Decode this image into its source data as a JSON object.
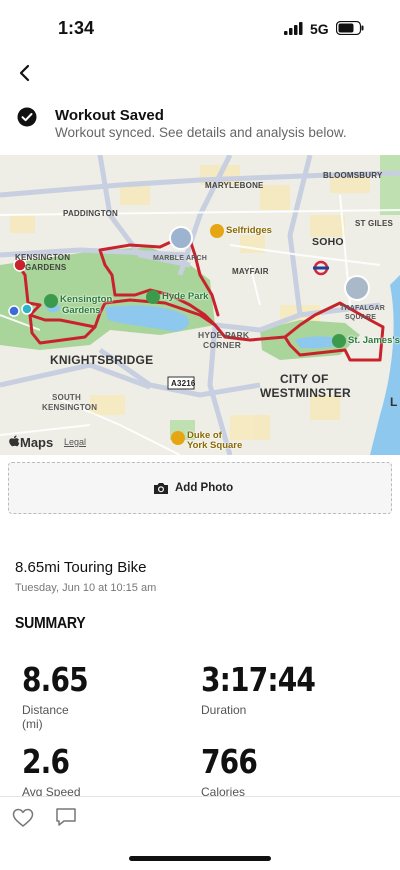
{
  "status": {
    "time": "1:34",
    "network": "5G"
  },
  "saved": {
    "title": "Workout Saved",
    "subtitle": "Workout synced. See details and analysis below."
  },
  "map": {
    "labels": [
      "MARYLEBONE",
      "BLOOMSBURY",
      "PADDINGTON",
      "ST GILES",
      "SOHO",
      "KENSINGTON",
      "GARDENS",
      "MARBLE ARCH",
      "MAYFAIR",
      "TRAFALGAR",
      "SQUARE",
      "HYDE PARK",
      "CORNER",
      "KNIGHTSBRIDGE",
      "CITY OF",
      "WESTMINSTER",
      "SOUTH",
      "KENSINGTON",
      "A3216",
      "L"
    ],
    "pois": [
      "Selfridges",
      "Kensington",
      "Gardens",
      "Hyde Park",
      "St. James's",
      "Duke of",
      "York Square"
    ],
    "attribution": "Maps",
    "legal": "Legal",
    "route_color": "#c8232c"
  },
  "add_photo": {
    "label": "Add Photo"
  },
  "workout": {
    "title": "8.65mi Touring Bike",
    "date": "Tuesday, Jun 10 at 10:15 am"
  },
  "summary": {
    "heading": "SUMMARY",
    "stats": [
      {
        "value": "8.65",
        "label": "Distance",
        "label2": "(mi)"
      },
      {
        "value": "3:17:44",
        "label": "Duration",
        "label2": ""
      },
      {
        "value": "2.6",
        "label": "Avg Speed",
        "label2": ""
      },
      {
        "value": "766",
        "label": "Calories",
        "label2": ""
      }
    ]
  }
}
